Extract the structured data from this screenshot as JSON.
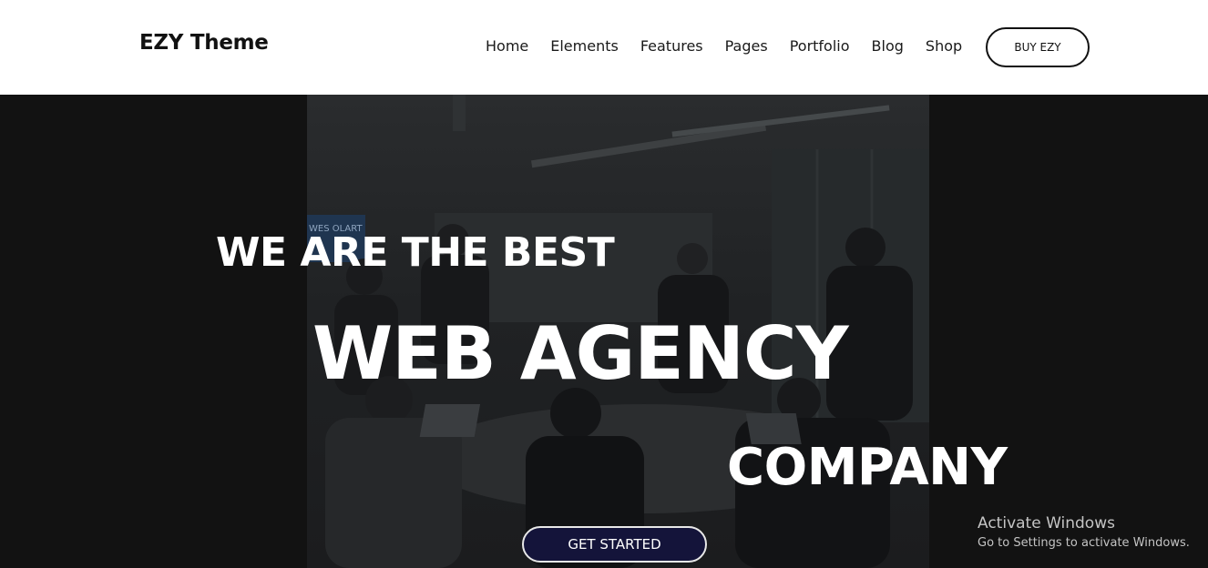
{
  "header": {
    "logo_text": "EZY Theme",
    "nav": [
      {
        "label": "Home"
      },
      {
        "label": "Elements"
      },
      {
        "label": "Features"
      },
      {
        "label": "Pages"
      },
      {
        "label": "Portfolio"
      },
      {
        "label": "Blog"
      },
      {
        "label": "Shop"
      }
    ],
    "buy_label": "BUY EZY"
  },
  "hero": {
    "line1": "WE ARE THE BEST",
    "line2": "WEB AGENCY",
    "line3": "COMPANY",
    "cta_label": "GET STARTED",
    "photo_sign": "WES OLART"
  },
  "watermark": {
    "title": "Activate Windows",
    "subtitle": "Go to Settings to activate Windows."
  },
  "colors": {
    "header_bg": "#ffffff",
    "hero_bg": "#121212",
    "cta_bg": "#14143a",
    "text_light": "#ffffff",
    "text_dark": "#111111"
  }
}
